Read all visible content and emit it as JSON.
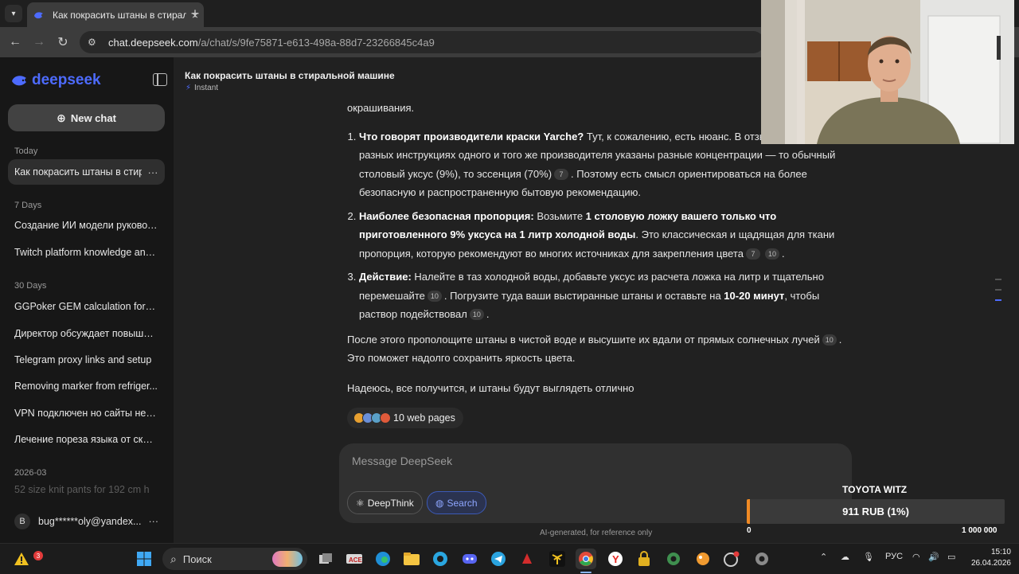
{
  "browser": {
    "tab_title": "Как покрасить штаны в стирал",
    "new_tab_label": "+",
    "url_host": "chat.deepseek.com",
    "url_path": "/a/chat/s/9fe75871-e613-498a-88d7-23266845c4a9"
  },
  "sidebar": {
    "logo_text": "deepseek",
    "new_chat_label": "New chat",
    "sections": [
      {
        "label": "Today",
        "items": [
          {
            "title": "Как покрасить штаны в стирал",
            "active": true
          }
        ]
      },
      {
        "label": "7 Days",
        "items": [
          {
            "title": "Создание ИИ модели руководс..."
          },
          {
            "title": "Twitch platform knowledge and..."
          }
        ]
      },
      {
        "label": "30 Days",
        "items": [
          {
            "title": "GGPoker GEM calculation for r..."
          },
          {
            "title": "Директор обсуждает повышени..."
          },
          {
            "title": "Telegram proxy links and setup"
          },
          {
            "title": "Removing marker from refriger..."
          },
          {
            "title": "VPN подключен но сайты не от..."
          },
          {
            "title": "Лечение пореза языка от сколо..."
          }
        ]
      },
      {
        "label": "2026-03",
        "items": [
          {
            "title": "52 size knit pants for 192 cm h"
          }
        ]
      }
    ],
    "user": {
      "avatar_letter": "B",
      "email": "bug******oly@yandex..."
    }
  },
  "conversation": {
    "title": "Как покрасить штаны в стиральной машине",
    "mode": "Instant",
    "intro_tail": "окрашивания.",
    "items": [
      {
        "bold": "Что говорят производители краски Yarche?",
        "text1": " Тут, к сожалению, есть нюанс. В отзывах пишут, что в разных инструкциях одного и того же производителя указаны разные концентрации — то обычный столовый уксус (9%), то эссенция (70%)",
        "cite1": "7",
        "text2": ". Поэтому есть смысл ориентироваться на более безопасную и распространенную бытовую рекомендацию."
      },
      {
        "bold": "Наиболее безопасная пропорция:",
        "text1": " Возьмите ",
        "bold2": "1 столовую ложку вашего только что приготовленного 9% уксуса на 1 литр холодной воды",
        "text2": ". Это классическая и щадящая для ткани пропорция, которую рекомендуют во многих источниках для закрепления цвета",
        "cite1": "7",
        "cite2": "10",
        "text3": "."
      },
      {
        "bold": "Действие:",
        "text1": " Налейте в таз холодной воды, добавьте уксус из расчета ложка на литр и тщательно перемешайте",
        "cite1": "10",
        "text2": ". Погрузите туда ваши выстиранные штаны и оставьте на ",
        "bold2": "10-20 минут",
        "text3": ", чтобы раствор подействовал",
        "cite2": "10",
        "text4": "."
      }
    ],
    "after_text": "После этого прополощите штаны в чистой воде и высушите их вдали от прямых солнечных лучей",
    "after_cite": "10",
    "after_text2": ". Это поможет надолго сохранить яркость цвета.",
    "closing": "Надеюсь, все получится, и штаны будут выглядеть отлично",
    "web_pages": "10 web pages"
  },
  "composer": {
    "placeholder": "Message DeepSeek",
    "deepthink_label": "DeepThink",
    "search_label": "Search",
    "disclaimer": "AI-generated, for reference only"
  },
  "donation": {
    "goal_title": "TOYOTA WITZ",
    "progress_text": "911 RUB (1%)",
    "progress_fraction": 0.01,
    "min_label": "0",
    "max_label": "1 000 000",
    "fill_color": "#f08a24"
  },
  "taskbar": {
    "search_label": "Поиск",
    "notification_count": "3",
    "language": "РУС",
    "time": "15:10",
    "date": "26.04.2026"
  },
  "colors": {
    "accent": "#4d6bfe",
    "background": "#212121",
    "sidebar": "#171717"
  }
}
